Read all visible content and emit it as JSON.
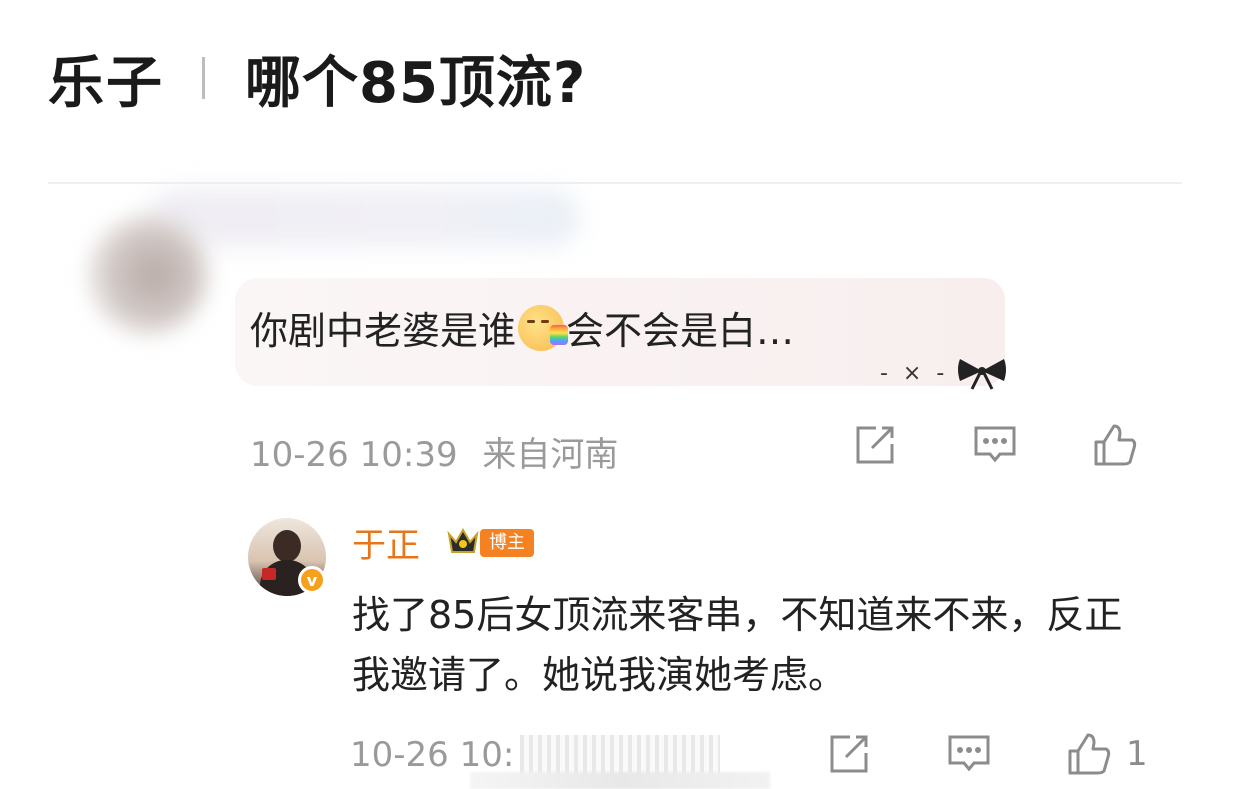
{
  "header": {
    "channel": "乐子",
    "question": "哪个85顶流?"
  },
  "comment": {
    "text_before_emoji": "你剧中老婆是谁",
    "emoji": "rainbow-puke-emoji",
    "text_after_emoji": "会不会是白…",
    "decoration": "- × -",
    "timestamp": "10-26 10:39",
    "location": "来自河南"
  },
  "reply": {
    "author": "于正",
    "badge": "博主",
    "verified_mark": "v",
    "text": "找了85后女顶流来客串，不知道来不来，反正我邀请了。她说我演她考虑。",
    "timestamp": "10-26 10:",
    "like_count": "1"
  },
  "colors": {
    "author": "#e8751a",
    "badge_bg": "#f58220",
    "meta": "#9a9a9a",
    "icon": "#8c8c8c"
  }
}
